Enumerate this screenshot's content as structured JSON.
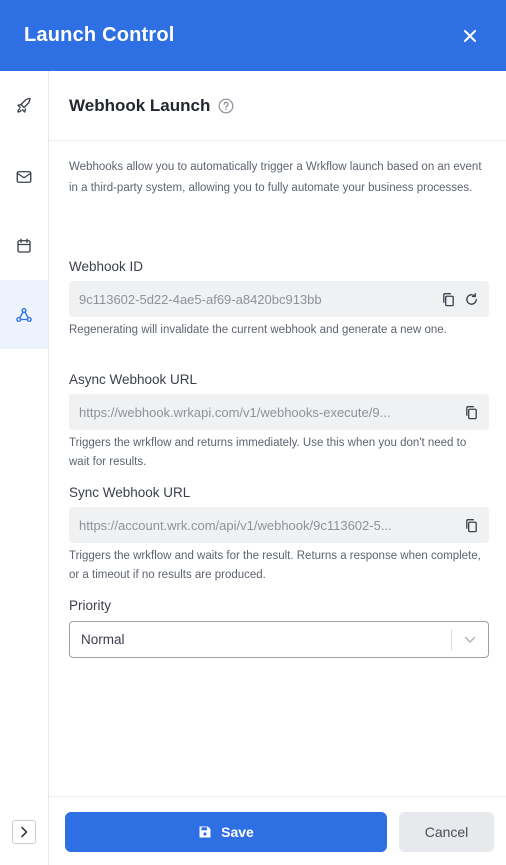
{
  "header": {
    "title": "Launch Control",
    "close_icon": "close-icon"
  },
  "sidebar": {
    "items": [
      {
        "name": "rocket",
        "icon": "rocket-icon",
        "active": false
      },
      {
        "name": "email",
        "icon": "mail-icon",
        "active": false
      },
      {
        "name": "schedule",
        "icon": "calendar-icon",
        "active": false
      },
      {
        "name": "webhook",
        "icon": "webhook-icon",
        "active": true
      }
    ],
    "expand_icon": "chevron-right-icon"
  },
  "panel": {
    "title": "Webhook Launch",
    "help_icon": "help-circle-icon",
    "description": "Webhooks allow you to automatically trigger a Wrkflow launch based on an event in a third-party system, allowing you to fully automate your business processes."
  },
  "webhook_id": {
    "label": "Webhook ID",
    "value": "9c113602-5d22-4ae5-af69-a8420bc913bb",
    "hint": "Regenerating will invalidate the current webhook and generate a new one."
  },
  "async_url": {
    "label": "Async Webhook URL",
    "value": "https://webhook.wrkapi.com/v1/webhooks-execute/9...",
    "hint": "Triggers the wrkflow and returns immediately. Use this when you don't need to wait for results."
  },
  "sync_url": {
    "label": "Sync Webhook URL",
    "value": "https://account.wrk.com/api/v1/webhook/9c113602-5...",
    "hint": "Triggers the wrkflow and waits for the result. Returns a response when complete, or a timeout if no results are produced."
  },
  "priority": {
    "label": "Priority",
    "selected": "Normal"
  },
  "footer": {
    "save_label": "Save",
    "cancel_label": "Cancel"
  },
  "colors": {
    "accent": "#2f6fe4",
    "active_bg": "#edf3fd"
  }
}
